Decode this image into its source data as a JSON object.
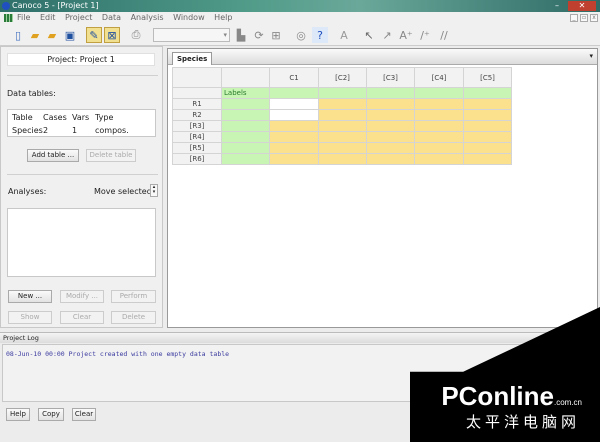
{
  "window": {
    "title": "Canoco 5 - [Project 1]",
    "minimize": "–",
    "maximize": "□",
    "close": "✕"
  },
  "menu": [
    "File",
    "Edit",
    "Project",
    "Data",
    "Analysis",
    "Window",
    "Help"
  ],
  "left": {
    "project_label": "Project: Project 1",
    "data_tables_label": "Data tables:",
    "table_headers": [
      "Table",
      "Cases",
      "Vars",
      "Type"
    ],
    "table_rows": [
      [
        "Species",
        "2",
        "1",
        "compos."
      ]
    ],
    "add_table": "Add table ...",
    "delete_table": "Delete table",
    "analyses_label": "Analyses:",
    "move_selected": "Move selected:",
    "new": "New ...",
    "modify": "Modify ...",
    "perform": "Perform",
    "show": "Show",
    "clear": "Clear",
    "delete": "Delete"
  },
  "sheet": {
    "tab": "Species",
    "columns": [
      "C1",
      "[C2]",
      "[C3]",
      "[C4]",
      "[C5]"
    ],
    "labels_cell": "Labels",
    "rows": [
      "R1",
      "R2",
      "[R3]",
      "[R4]",
      "[R5]",
      "[R6]"
    ]
  },
  "log": {
    "title": "Project Log",
    "entries": [
      "08-Jun-10 00:00 Project created with one empty data table"
    ],
    "help": "Help",
    "copy": "Copy",
    "clear": "Clear"
  },
  "watermark": {
    "logo": "PConline",
    "domain": ".com.cn",
    "chinese": "太平洋电脑网"
  }
}
